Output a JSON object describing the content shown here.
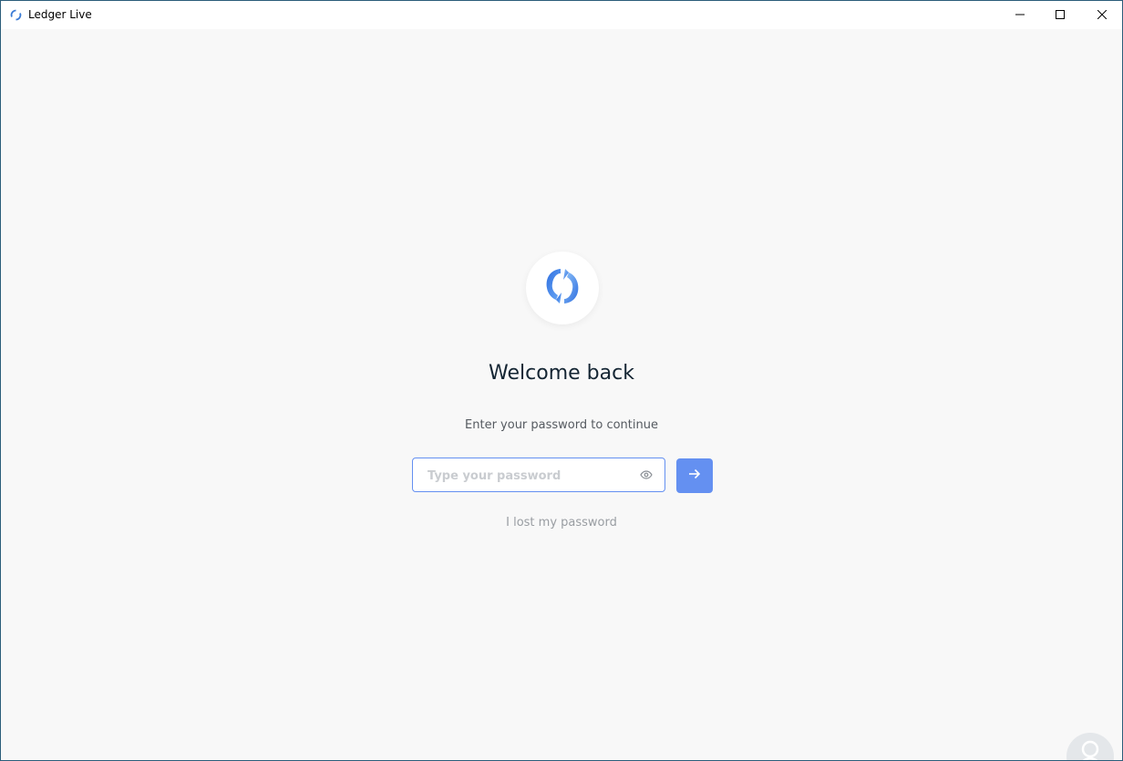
{
  "window": {
    "title": "Ledger Live",
    "app_icon": "ledger-live-icon",
    "controls": {
      "minimize_icon": "minimize-icon",
      "maximize_icon": "maximize-icon",
      "close_icon": "close-icon"
    }
  },
  "login": {
    "logo_icon": "ledger-sync-logo-icon",
    "heading": "Welcome back",
    "subtitle": "Enter your password to continue",
    "password": {
      "value": "",
      "placeholder": "Type your password",
      "reveal_icon": "eye-icon"
    },
    "submit_icon": "arrow-right-icon",
    "lost_password": "I lost my password"
  },
  "colors": {
    "accent": "#6490f1",
    "background": "#f8f8f8",
    "heading": "#142533",
    "muted": "#999da2",
    "subtitle": "#555a60"
  },
  "overlay": {
    "watermark_icon": "person-silhouette-logo-icon"
  }
}
